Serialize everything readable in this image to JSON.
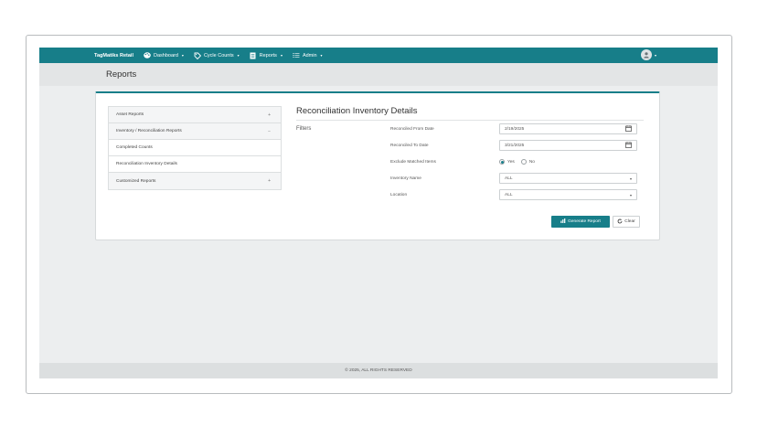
{
  "navbar": {
    "brand": "TagMatiks Retail",
    "items": [
      {
        "label": "Dashboard",
        "icon": "palette-icon"
      },
      {
        "label": "Cycle Counts",
        "icon": "tag-icon"
      },
      {
        "label": "Reports",
        "icon": "report-icon"
      },
      {
        "label": "Admin",
        "icon": "list-icon"
      }
    ],
    "user_icon": "user-avatar-icon"
  },
  "page": {
    "title": "Reports"
  },
  "sidebar": {
    "items": [
      {
        "label": "Asset Reports",
        "mark": "+"
      },
      {
        "label": "Inventory / Reconciliation Reports",
        "mark": "−"
      },
      {
        "label": "Completed Counts",
        "mark": ""
      },
      {
        "label": "Reconciliation Inventory Details",
        "mark": ""
      },
      {
        "label": "Customized Reports",
        "mark": "+"
      }
    ]
  },
  "content": {
    "title": "Reconciliation Inventory Details",
    "filters_label": "Filters",
    "filters": {
      "from_date": {
        "label": "Reconciled From Date",
        "value": "2/19/2025"
      },
      "to_date": {
        "label": "Reconciled To Date",
        "value": "3/21/2025"
      },
      "exclude": {
        "label": "Exclude Matched Items",
        "yes": "Yes",
        "no": "No",
        "selected": "Yes"
      },
      "inventory": {
        "label": "Inventory Name",
        "value": "ALL"
      },
      "location": {
        "label": "Location",
        "value": "ALL"
      }
    },
    "generate_label": "Generate Report",
    "clear_label": "Clear"
  },
  "footer": {
    "text": "© 2025, ALL RIGHTS RESERVED"
  },
  "colors": {
    "accent": "#177e89",
    "background": "#eceeef"
  }
}
